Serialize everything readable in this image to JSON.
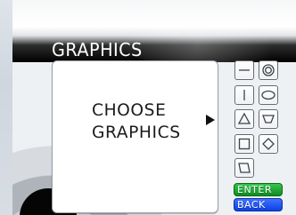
{
  "screen": {
    "title": "GRAPHICS"
  },
  "dialog": {
    "prompt": "CHOOSE\nGRAPHICS"
  },
  "palette": {
    "tools": [
      {
        "label": "",
        "icon": "horizontal-line-icon"
      },
      {
        "label": "",
        "icon": "concentric-circle-icon"
      },
      {
        "label": "",
        "icon": "vertical-line-icon"
      },
      {
        "label": "",
        "icon": "ellipse-icon"
      },
      {
        "label": "",
        "icon": "triangle-icon"
      },
      {
        "label": "",
        "icon": "trapezoid-icon"
      },
      {
        "label": "",
        "icon": "square-icon"
      },
      {
        "label": "",
        "icon": "diamond-icon"
      },
      {
        "label": "",
        "icon": "parallelogram-icon"
      }
    ],
    "enter_label": "ENTER",
    "back_label": "BACK"
  },
  "colors": {
    "accent_green": "#14a32b",
    "accent_blue": "#164ff5",
    "header_dark": "#000000"
  }
}
